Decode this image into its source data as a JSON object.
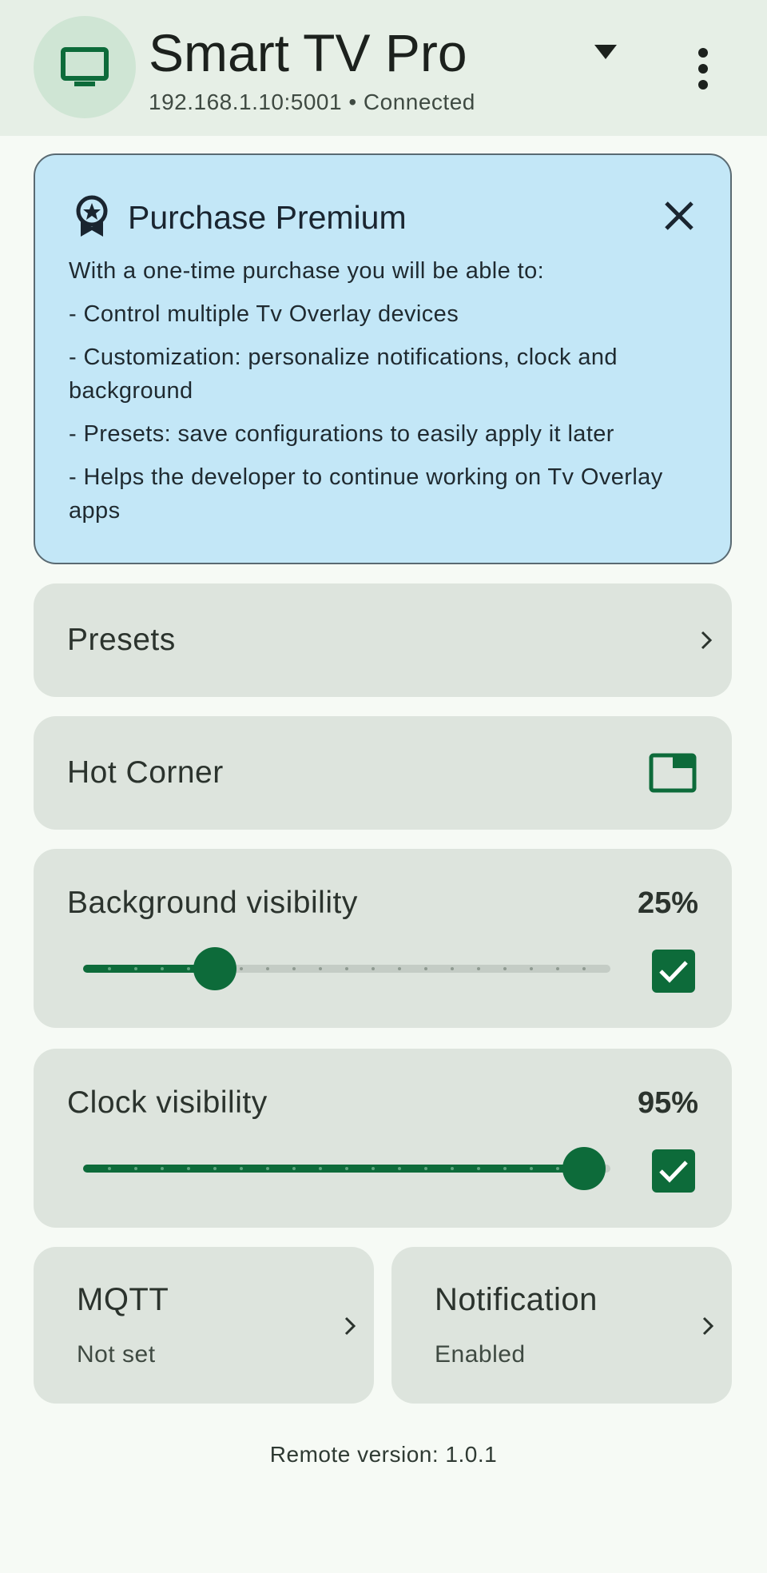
{
  "header": {
    "device_name": "Smart TV Pro",
    "device_status": "192.168.1.10:5001 • Connected",
    "icons": [
      "tv-icon",
      "dropdown-icon",
      "more-vert-icon"
    ]
  },
  "premium": {
    "title": "Purchase Premium",
    "lines": [
      "With a one-time purchase you will be able to:",
      "- Control multiple Tv Overlay devices",
      "- Customization: personalize notifications, clock and background",
      "- Presets: save configurations to easily apply it later",
      "- Helps the developer to continue working on Tv Overlay apps"
    ]
  },
  "presets": {
    "label": "Presets"
  },
  "hot_corner": {
    "label": "Hot Corner"
  },
  "background_visibility": {
    "label": "Background visibility",
    "percent_label": "25%",
    "value": 0.25,
    "enabled": true
  },
  "clock_visibility": {
    "label": "Clock visibility",
    "percent_label": "95%",
    "value": 0.95,
    "enabled": true
  },
  "mqtt": {
    "label": "MQTT",
    "status": "Not set"
  },
  "notification": {
    "label": "Notification",
    "status": "Enabled"
  },
  "footer": {
    "version": "Remote version: 1.0.1"
  },
  "colors": {
    "accent": "#0d6b3a",
    "premium_bg": "#c3e7f7",
    "card_bg": "#dde4dd",
    "header_bg": "#e6efe6"
  }
}
